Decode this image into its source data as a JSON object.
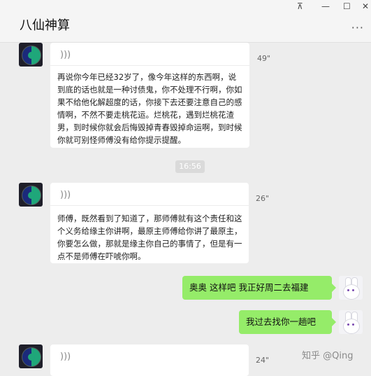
{
  "window": {
    "title": "八仙神算",
    "controls": {
      "pin": "⊼",
      "minimize": "—",
      "maximize": "☐",
      "close": "✕"
    },
    "more": "···"
  },
  "messages": [
    {
      "side": "left",
      "type": "voice",
      "duration": "49\"",
      "transcript": "再说你今年已经32岁了，像今年这样的东西啊，说到底的话也就是一种讨债鬼，你不处理不行啊，你如果不给他化解超度的话，你接下去还要注意自己的感情啊，不然不要走桃花运。烂桃花，遇到烂桃花渣男，到时候你就会后悔毁掉青春毁掉命运啊，到时候你就可别怪师傅没有给你提示提醒。"
    },
    {
      "type": "time",
      "text": "16:56"
    },
    {
      "side": "left",
      "type": "voice",
      "duration": "26\"",
      "transcript": "师傅，既然看到了知道了，那师傅就有这个责任和这个义务给缘主你讲啊，最原主师傅给你讲了最原主，你要怎么做，那就是缘主你自己的事情了，但是有一点不是师傅在吓唬你啊。"
    },
    {
      "side": "right",
      "type": "text",
      "text": "奥奥  这样吧 我正好周二去福建"
    },
    {
      "side": "right",
      "type": "text",
      "text": "我过去找你一趟吧"
    },
    {
      "side": "left",
      "type": "voice",
      "duration": "24\"",
      "transcript": ""
    }
  ],
  "voice_icon": ")))",
  "watermark": "知乎 @Qing"
}
